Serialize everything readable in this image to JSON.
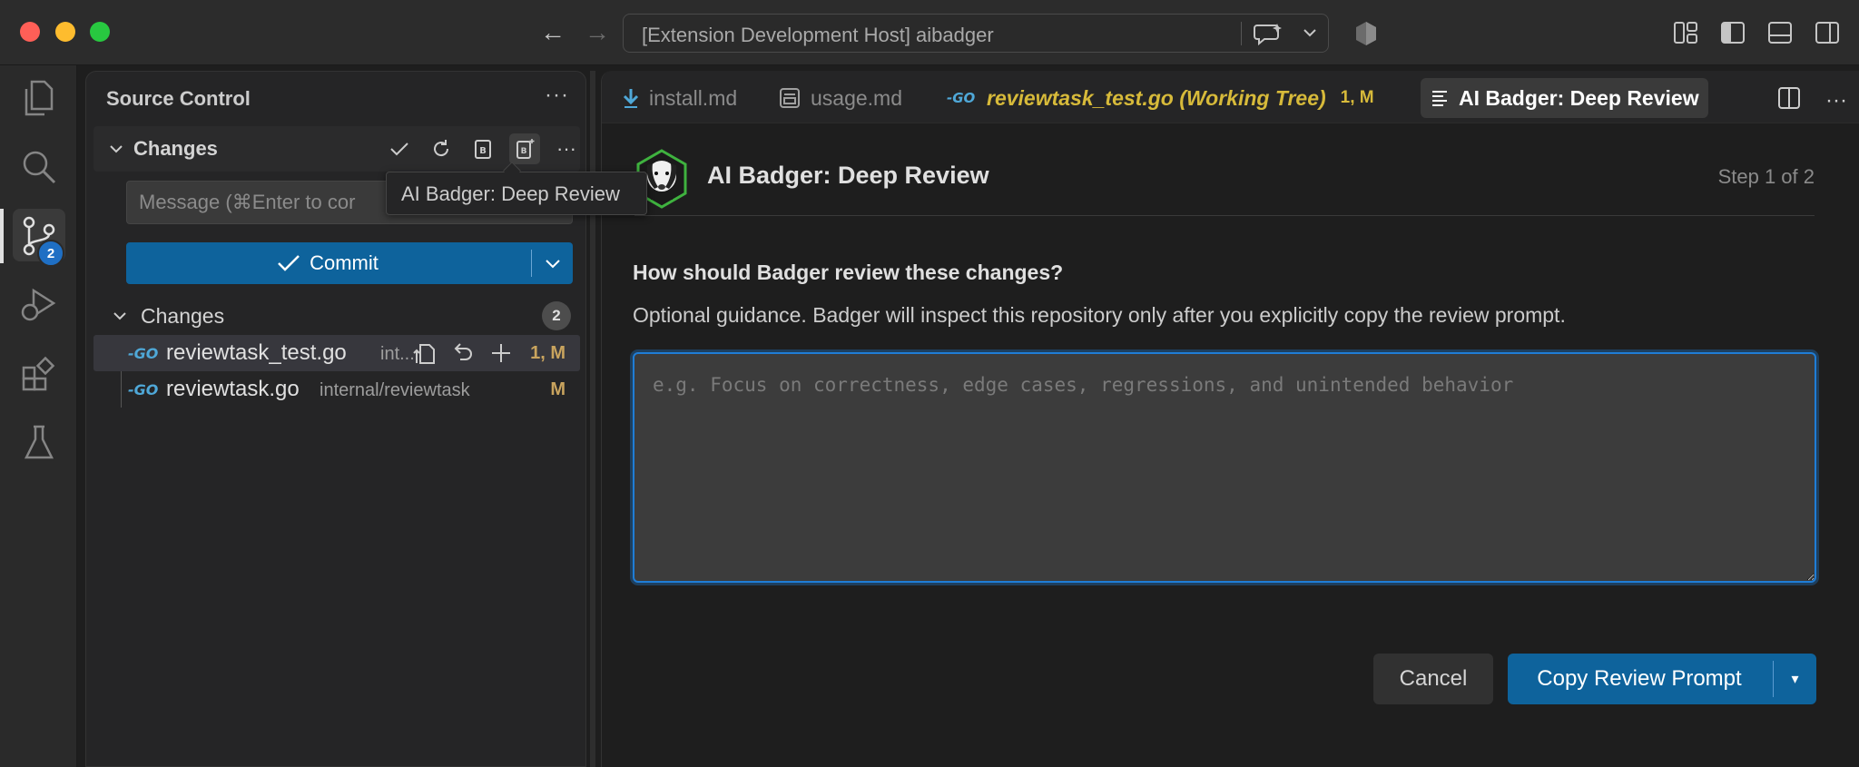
{
  "window": {
    "command_center": "[Extension Development Host] aibadger"
  },
  "activity_bar": {
    "scm_badge": "2"
  },
  "sidebar": {
    "title": "Source Control",
    "section_label": "Changes",
    "message_placeholder": "Message (⌘Enter to commit on 'main')",
    "message_visible": "Message (⌘Enter to cor",
    "commit_label": "Commit",
    "group_label": "Changes",
    "group_count": "2",
    "files": [
      {
        "name": "reviewtask_test.go",
        "path": "int...",
        "status": "1, M"
      },
      {
        "name": "reviewtask.go",
        "path": "internal/reviewtask",
        "status": "M"
      }
    ]
  },
  "tooltip": {
    "text": "AI Badger: Deep Review"
  },
  "tabs": [
    {
      "label": "install.md",
      "icon": "download-arrow-icon"
    },
    {
      "label": "usage.md",
      "icon": "preview-icon"
    },
    {
      "label": "reviewtask_test.go (Working Tree)",
      "status": "1, M",
      "icon": "go-icon"
    },
    {
      "label": "AI Badger: Deep Review",
      "icon": "lines-icon"
    }
  ],
  "panel": {
    "title": "AI Badger: Deep Review",
    "step": "Step 1 of 2",
    "question": "How should Badger review these changes?",
    "guidance": "Optional guidance. Badger will inspect this repository only after you explicitly copy the review prompt.",
    "placeholder": "e.g. Focus on correctness, edge cases, regressions, and unintended behavior",
    "cancel_label": "Cancel",
    "primary_label": "Copy Review Prompt",
    "primary_dropdown": "▾"
  },
  "colors": {
    "accent": "#0e639c",
    "focus": "#1f7dd6",
    "modified": "#d7ba3a"
  }
}
